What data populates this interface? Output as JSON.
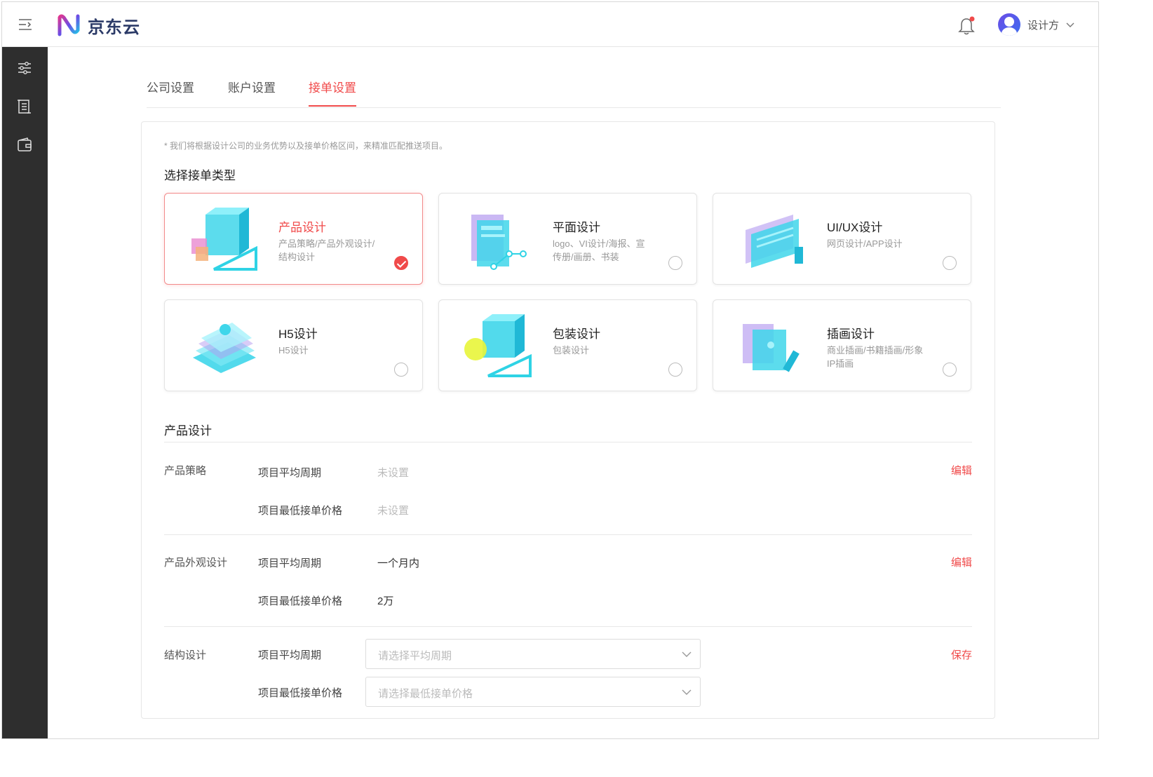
{
  "header": {
    "logo_text": "京东云",
    "user_name": "设计方"
  },
  "tabs": [
    {
      "label": "公司设置"
    },
    {
      "label": "账户设置"
    },
    {
      "label": "接单设置"
    }
  ],
  "panel": {
    "hint": "* 我们将根据设计公司的业务优势以及接单价格区间，来精准匹配推送项目。",
    "section_title": "选择接单类型",
    "cards": [
      {
        "title": "产品设计",
        "desc": "产品策略/产品外观设计/结构设计",
        "selected": true
      },
      {
        "title": "平面设计",
        "desc": "logo、VI设计/海报、宣传册/画册、书装",
        "selected": false
      },
      {
        "title": "UI/UX设计",
        "desc": "网页设计/APP设计",
        "selected": false
      },
      {
        "title": "H5设计",
        "desc": "H5设计",
        "selected": false
      },
      {
        "title": "包装设计",
        "desc": "包装设计",
        "selected": false
      },
      {
        "title": "插画设计",
        "desc": "商业插画/书籍插画/形象IP插画",
        "selected": false
      }
    ],
    "detail_title": "产品设计",
    "rows": [
      {
        "label": "产品策略",
        "period_label": "项目平均周期",
        "period_value": "未设置",
        "price_label": "项目最低接单价格",
        "price_value": "未设置",
        "action": "编辑"
      },
      {
        "label": "产品外观设计",
        "period_label": "项目平均周期",
        "period_value": "一个月内",
        "price_label": "项目最低接单价格",
        "price_value": "2万",
        "action": "编辑"
      },
      {
        "label": "结构设计",
        "period_label": "项目平均周期",
        "period_placeholder": "请选择平均周期",
        "price_label": "项目最低接单价格",
        "price_placeholder": "请选择最低接单价格",
        "action": "保存"
      }
    ]
  },
  "colors": {
    "accent": "#f04a4a",
    "sidebar": "#2e2e2e",
    "illustration": "#3fd6ea"
  }
}
